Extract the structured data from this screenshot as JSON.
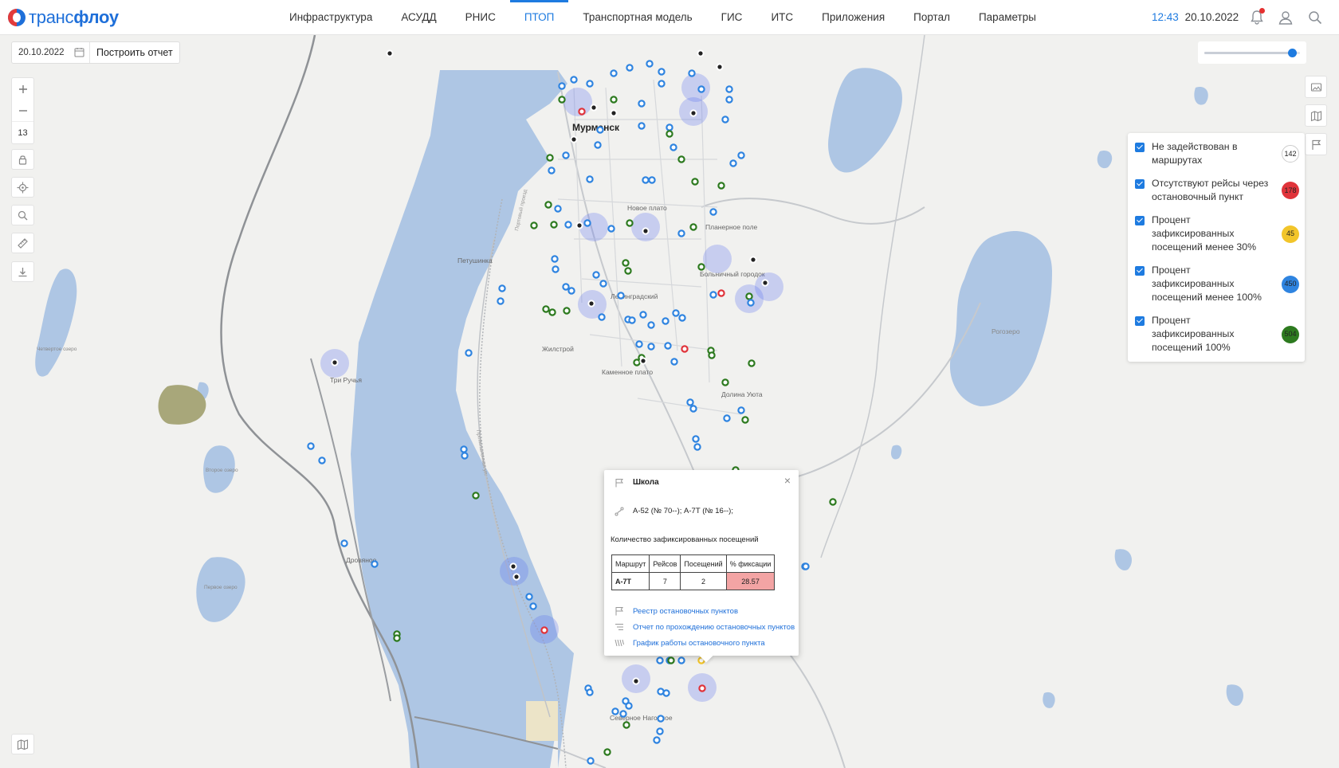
{
  "header": {
    "logo_text_a": "транс",
    "logo_text_b": "флоу",
    "nav": [
      {
        "label": "Инфраструктура"
      },
      {
        "label": "АСУДД"
      },
      {
        "label": "РНИС"
      },
      {
        "label": "ПТОП",
        "active": true
      },
      {
        "label": "Транспортная модель"
      },
      {
        "label": "ГИС"
      },
      {
        "label": "ИТС"
      },
      {
        "label": "Приложения"
      },
      {
        "label": "Портал"
      },
      {
        "label": "Параметры"
      }
    ],
    "time": "12:43",
    "date": "20.10.2022",
    "icons": [
      "bell-icon",
      "user-icon",
      "search-icon"
    ],
    "accent_color": "#1e7be0"
  },
  "toolbar": {
    "date_value": "20.10.2022",
    "build_report_label": "Построить отчет",
    "zoom_level": "13",
    "tools": [
      "plus-icon",
      "minus-icon",
      "lock-icon",
      "locate-icon",
      "search-icon",
      "ruler-icon",
      "download-icon",
      "map-icon"
    ]
  },
  "opacity_slider": {
    "value": 0.92
  },
  "map_labels": {
    "city": "Мурманск",
    "novoe_plato": "Новое плато",
    "planernoe_pole": "Планерное поле",
    "petushinka": "Петушинка",
    "bolnichny": "Больничный городок",
    "leningradsky": "Ленинградский",
    "zhilstroy": "Жилстрой",
    "kamennoe_plato": "Каменное плато",
    "dolina_uyuta": "Долина Уюта",
    "tri_ruchya": "Три Ручья",
    "drovyanoe": "Дровяное",
    "severnoe_nagornoe": "Северное Нагорное",
    "rogozero": "Рогозеро",
    "chetvertoe_ozero": "Четвертое озеро",
    "vtoroe_ozero": "Второе озеро",
    "pervoe_ozero": "Первое озеро",
    "street_portovy": "Портовый проезд",
    "street_promyshlennaya": "Промышленная ул."
  },
  "legend": {
    "items": [
      {
        "label": "Не задействован в маршрутах",
        "count": "142",
        "color": "#ffffff"
      },
      {
        "label": "Отсутствуют рейсы через остановочный пункт",
        "count": "178",
        "color": "#e0343b"
      },
      {
        "label": "Процент зафиксированных посещений менее 30%",
        "count": "45",
        "color": "#f2c52a"
      },
      {
        "label": "Процент зафиксированных посещений менее 100%",
        "count": "450",
        "color": "#2f84e0"
      },
      {
        "label": "Процент зафиксированных посещений 100%",
        "count": "504",
        "color": "#2d7a1f"
      }
    ]
  },
  "popup": {
    "title": "Школа",
    "routes": "А-52 (№ 70--); А-7Т (№ 16--);",
    "subtitle": "Количество зафиксированных посещений",
    "table": {
      "headers": [
        "Маршрут",
        "Рейсов",
        "Посещений",
        "% фиксации"
      ],
      "rows": [
        [
          "А-7Т",
          "7",
          "2",
          "28.57"
        ]
      ]
    },
    "links": [
      "Реестр остановочных пунктов",
      "Отчет по прохождению остановочных пунктов",
      "График работы остановочного пункта"
    ]
  }
}
